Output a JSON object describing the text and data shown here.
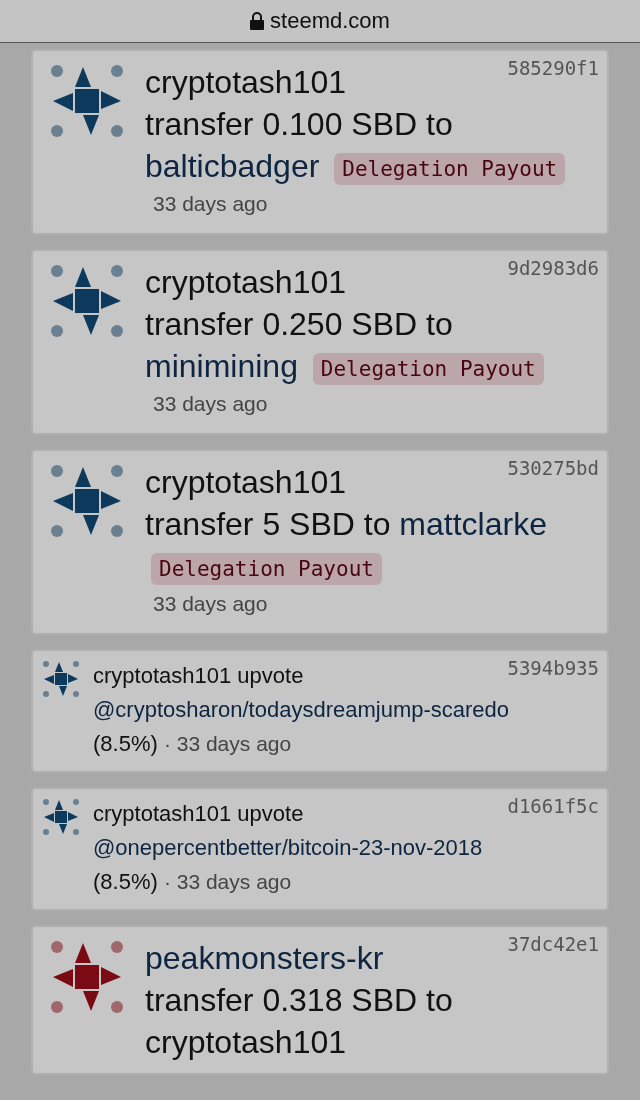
{
  "address_bar": {
    "url": "steemd.com"
  },
  "operations": [
    {
      "kind": "transfer",
      "color": "#0d3a5c",
      "hash": "585290f1",
      "from": {
        "name": "cryptotash101",
        "self": true
      },
      "action": "transfer 0.100 SBD to",
      "to": {
        "name": "balticbadger",
        "self": false
      },
      "tag": "Delegation Payout",
      "time": "33 days ago"
    },
    {
      "kind": "transfer",
      "color": "#0d3a5c",
      "hash": "9d2983d6",
      "from": {
        "name": "cryptotash101",
        "self": true
      },
      "action": "transfer 0.250 SBD to",
      "to": {
        "name": "minimining",
        "self": false
      },
      "tag": "Delegation Payout",
      "time": "33 days ago"
    },
    {
      "kind": "transfer",
      "color": "#0d3a5c",
      "hash": "530275bd",
      "from": {
        "name": "cryptotash101",
        "self": true
      },
      "action": "transfer 5 SBD to",
      "to": {
        "name": "mattclarke",
        "self": false
      },
      "tag": "Delegation Payout",
      "time": "33 days ago"
    },
    {
      "kind": "vote",
      "color": "#0d3a5c",
      "hash": "5394b935",
      "from": {
        "name": "cryptotash101",
        "self": true
      },
      "action": "upvote",
      "post": "@cryptosharon/todaysdreamjump-scaredo",
      "weight": "(8.5%)",
      "time": "· 33 days ago"
    },
    {
      "kind": "vote",
      "color": "#0d3a5c",
      "hash": "d1661f5c",
      "from": {
        "name": "cryptotash101",
        "self": true
      },
      "action": "upvote",
      "post": "@onepercentbetter/bitcoin-23-nov-2018",
      "weight": "(8.5%)",
      "time": "· 33 days ago"
    },
    {
      "kind": "transfer",
      "color": "#7a0a14",
      "hash": "37dc42e1",
      "from": {
        "name": "peakmonsters-kr",
        "self": false
      },
      "action": "transfer 0.318 SBD to",
      "to": {
        "name": "cryptotash101",
        "self": true
      }
    }
  ]
}
